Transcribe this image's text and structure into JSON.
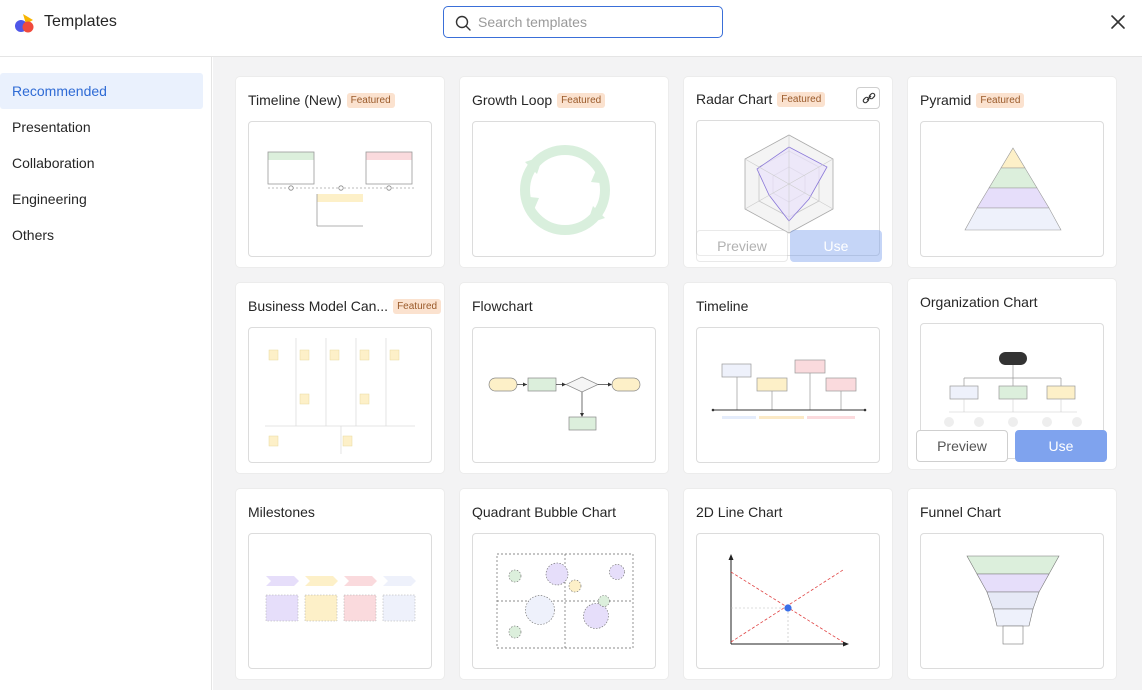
{
  "header": {
    "title": "Templates",
    "search_placeholder": "Search templates",
    "search_value": ""
  },
  "sidebar": {
    "items": [
      {
        "label": "Recommended",
        "active": true
      },
      {
        "label": "Presentation",
        "active": false
      },
      {
        "label": "Collaboration",
        "active": false
      },
      {
        "label": "Engineering",
        "active": false
      },
      {
        "label": "Others",
        "active": false
      }
    ]
  },
  "badge_label": "Featured",
  "cards": [
    {
      "title": "Timeline (New)",
      "featured": true
    },
    {
      "title": "Growth Loop",
      "featured": true
    },
    {
      "title": "Radar Chart",
      "featured": true
    },
    {
      "title": "Pyramid",
      "featured": true
    },
    {
      "title": "Business Model Can...",
      "featured": true
    },
    {
      "title": "Flowchart",
      "featured": false
    },
    {
      "title": "Timeline",
      "featured": false
    },
    {
      "title": "Organization Chart",
      "featured": false
    },
    {
      "title": "Milestones",
      "featured": false
    },
    {
      "title": "Quadrant Bubble Chart",
      "featured": false
    },
    {
      "title": "2D Line Chart",
      "featured": false
    },
    {
      "title": "Funnel Chart",
      "featured": false
    }
  ],
  "hover_actions": {
    "preview_label": "Preview",
    "use_label": "Use"
  },
  "colors": {
    "accent": "#2f6bd5",
    "use_button": "#7fa3ee",
    "badge_bg": "#fbe2cf",
    "badge_text": "#9a5a2a"
  },
  "icons": [
    "logo-icon",
    "search-icon",
    "close-icon",
    "link-icon"
  ]
}
